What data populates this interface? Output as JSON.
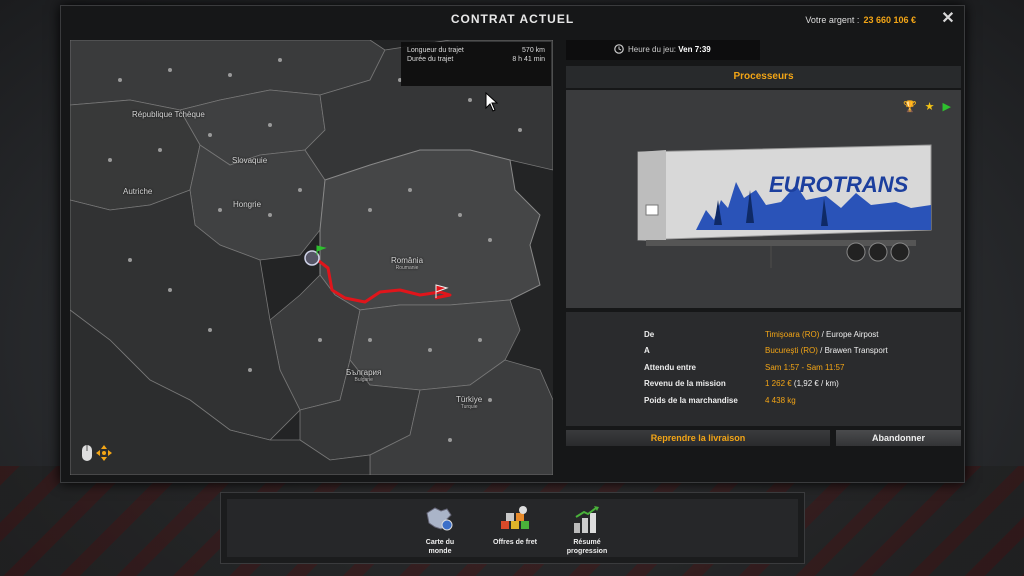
{
  "window": {
    "title": "CONTRAT ACTUEL"
  },
  "money": {
    "label": "Votre argent :",
    "value": "23 660 106 €"
  },
  "route": {
    "length_label": "Longueur du trajet",
    "length_value": "570 km",
    "duration_label": "Durée du trajet",
    "duration_value": "8 h 41 min"
  },
  "map_labels": {
    "republique_tcheque": "République Tchèque",
    "slovaquie": "Slovaquie",
    "autriche": "Autriche",
    "hongrie": "Hongrie",
    "romania": "România",
    "romania_sub": "Roumanie",
    "bulgaria": "България",
    "bulgaria_sub": "Bulgarie",
    "turkiye": "Türkiye",
    "turkiye_sub": "Turquie"
  },
  "game_time": {
    "label": "Heure du jeu:",
    "value": "Ven 7:39"
  },
  "cargo": {
    "name": "Processeurs",
    "trailer_brand": "EUROTRANS"
  },
  "details": {
    "from_label": "De",
    "from_city": "Timişoara (RO)",
    "from_company": " / Europe Airpost",
    "to_label": "A",
    "to_city": "Bucureşti (RO)",
    "to_company": " / Brawen Transport",
    "window_label": "Attendu entre",
    "window_value": "Sam 1:57 - Sam 11:57",
    "revenue_label": "Revenu de la mission",
    "revenue_value": "1 262 €",
    "revenue_rate": " (1,92 € / km)",
    "weight_label": "Poids de la marchandise",
    "weight_value": "4 438 kg"
  },
  "buttons": {
    "resume": "Reprendre la livraison",
    "abandon": "Abandonner"
  },
  "toolbar": {
    "world_map_line1": "Carte du",
    "world_map_line2": "monde",
    "freight": "Offres de fret",
    "progress_line1": "Résumé",
    "progress_line2": "progression"
  },
  "colors": {
    "accent": "#f3a516",
    "route": "#e0151b"
  }
}
